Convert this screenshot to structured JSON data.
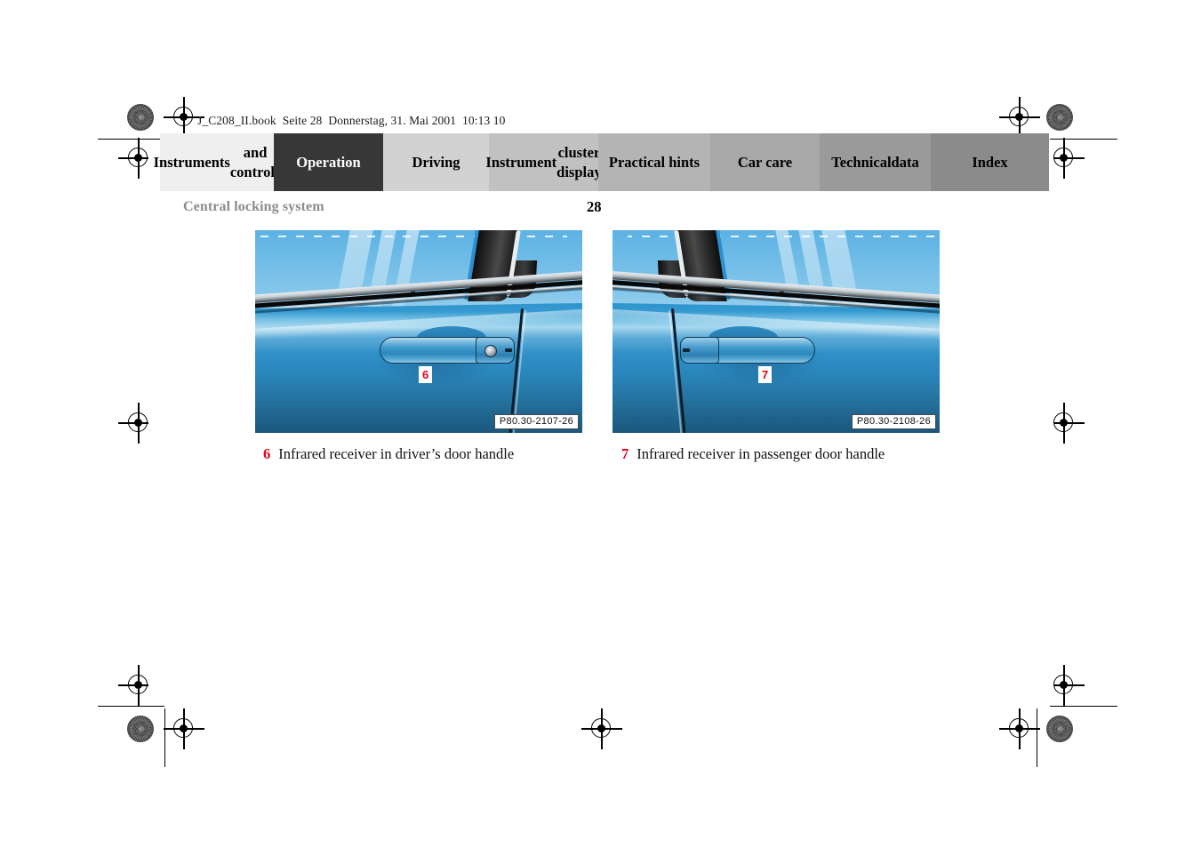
{
  "file_header": "J_C208_II.book  Seite 28  Donnerstag, 31. Mai 2001  10:13 10",
  "nav": {
    "tabs": [
      {
        "label": "Instruments\nand controls",
        "bg": "#efefef",
        "active": false
      },
      {
        "label": "Operation",
        "bg": "#373737",
        "active": true
      },
      {
        "label": "Driving",
        "bg": "#d2d2d2",
        "active": false
      },
      {
        "label": "Instrument\ncluster display",
        "bg": "#c1c1c1",
        "active": false
      },
      {
        "label": "Practical hints",
        "bg": "#b4b4b4",
        "active": false
      },
      {
        "label": "Car care",
        "bg": "#a8a8a8",
        "active": false
      },
      {
        "label": "Technical\ndata",
        "bg": "#9a9a9a",
        "active": false
      },
      {
        "label": "Index",
        "bg": "#8b8b8b",
        "active": false
      }
    ]
  },
  "running_head": "Central locking system",
  "page_number": "28",
  "figures": [
    {
      "callout": "6",
      "image_code": "P80.30-2107-26",
      "caption_number": "6",
      "caption_text": "Infrared receiver in driver’s door handle"
    },
    {
      "callout": "7",
      "image_code": "P80.30-2108-26",
      "caption_number": "7",
      "caption_text": "Infrared receiver in passenger door handle"
    }
  ],
  "colors": {
    "callout_red": "#e4001b",
    "running_head_gray": "#8c8c8c",
    "active_tab": "#373737"
  }
}
